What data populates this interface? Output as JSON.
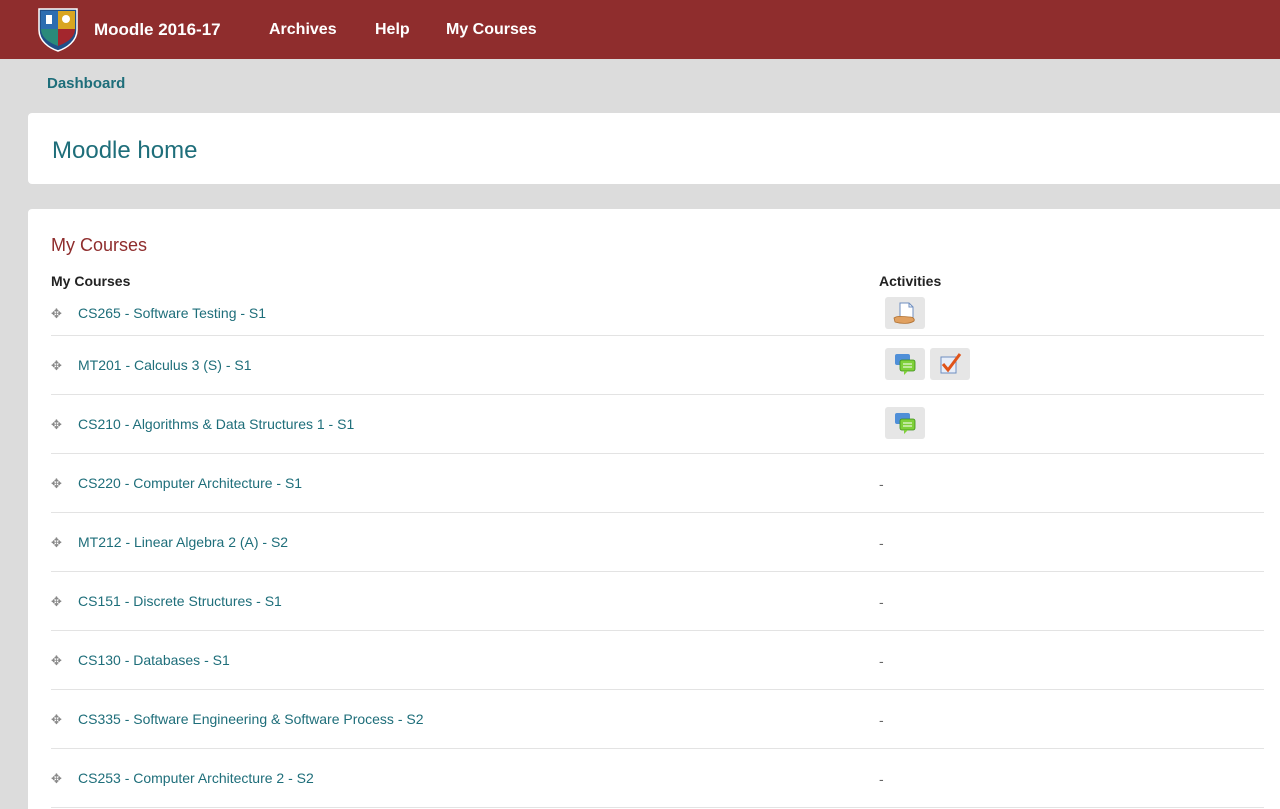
{
  "topbar": {
    "brand": "Moodle 2016-17",
    "nav": [
      {
        "label": "Archives"
      },
      {
        "label": "Help"
      },
      {
        "label": "My Courses"
      }
    ]
  },
  "breadcrumb": {
    "label": "Dashboard"
  },
  "page": {
    "title": "Moodle home"
  },
  "block": {
    "title": "My Courses",
    "col_courses": "My Courses",
    "col_activities": "Activities",
    "no_activity": "-",
    "courses": [
      {
        "name": "CS265 - Software Testing - S1",
        "activities": [
          "assignment-icon"
        ]
      },
      {
        "name": "MT201 - Calculus 3 (S) - S1",
        "activities": [
          "forum-icon",
          "quiz-icon"
        ]
      },
      {
        "name": "CS210 - Algorithms & Data Structures 1 - S1",
        "activities": [
          "forum-icon"
        ]
      },
      {
        "name": "CS220 - Computer Architecture - S1",
        "activities": []
      },
      {
        "name": "MT212 - Linear Algebra 2 (A) - S2",
        "activities": []
      },
      {
        "name": "CS151 - Discrete Structures - S1",
        "activities": []
      },
      {
        "name": "CS130 - Databases - S1",
        "activities": []
      },
      {
        "name": "CS335 - Software Engineering & Software Process - S2",
        "activities": []
      },
      {
        "name": "CS253 - Computer Architecture 2 - S2",
        "activities": []
      }
    ]
  },
  "colors": {
    "brand": "#8f2d2d",
    "link": "#1e6e7a"
  }
}
